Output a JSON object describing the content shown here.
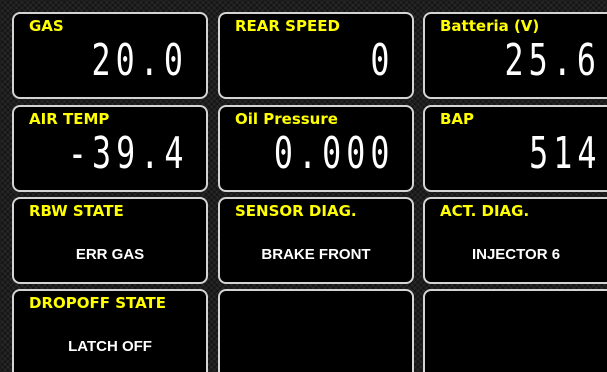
{
  "tiles": [
    {
      "label": "GAS",
      "value": "20.0",
      "display": "segment"
    },
    {
      "label": "REAR SPEED",
      "value": "0",
      "display": "segment"
    },
    {
      "label": "Batteria (V)",
      "value": "25.6",
      "display": "segment"
    },
    {
      "label": "AIR TEMP",
      "value": "-39.4",
      "display": "segment"
    },
    {
      "label": "Oil Pressure",
      "value": "0.000",
      "display": "segment"
    },
    {
      "label": "BAP",
      "value": "514",
      "display": "segment"
    },
    {
      "label": "RBW STATE",
      "value": "ERR GAS",
      "display": "text"
    },
    {
      "label": "SENSOR DIAG.",
      "value": "BRAKE FRONT",
      "display": "text"
    },
    {
      "label": "ACT. DIAG.",
      "value": "INJECTOR 6",
      "display": "text"
    },
    {
      "label": "DROPOFF STATE",
      "value": "LATCH OFF",
      "display": "text"
    },
    {
      "label": "",
      "value": "",
      "display": "empty"
    },
    {
      "label": "",
      "value": "",
      "display": "empty"
    }
  ],
  "colors": {
    "label": "#ffff00",
    "value": "#ffffff",
    "tile_bg": "#000000",
    "tile_border": "#d4d4d4",
    "background": "#1e1e1e"
  }
}
